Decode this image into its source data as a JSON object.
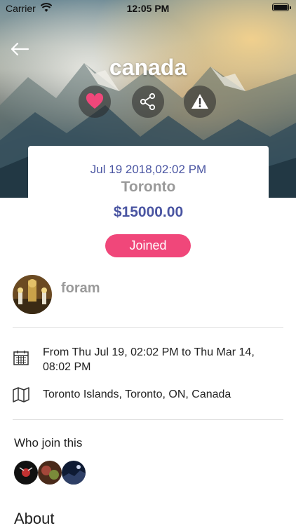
{
  "status_bar": {
    "carrier": "Carrier",
    "time": "12:05 PM"
  },
  "event": {
    "title": "canada",
    "date": "Jul 19 2018,02:02 PM",
    "city": "Toronto",
    "price": "$15000.00",
    "join_label": "Joined"
  },
  "host": {
    "name": "foram"
  },
  "details": {
    "schedule": "From Thu Jul 19, 02:02 PM to Thu Mar 14, 08:02 PM",
    "location": "Toronto Islands, Toronto, ON, Canada"
  },
  "participants": {
    "heading": "Who join this"
  },
  "about": {
    "heading": "About"
  },
  "colors": {
    "accent": "#f0477a",
    "primary_text": "#4a55a2",
    "muted": "#9a9a9a"
  },
  "icons": [
    "back-arrow-icon",
    "heart-icon",
    "share-icon",
    "warning-icon",
    "calendar-icon",
    "map-icon",
    "wifi-icon",
    "battery-icon"
  ]
}
